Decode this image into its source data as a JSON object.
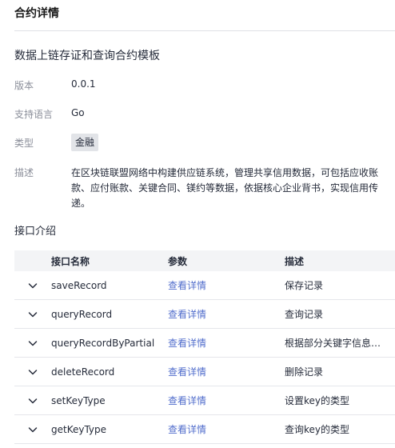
{
  "header": {
    "title": "合约详情"
  },
  "template": {
    "name": "数据上链存证和查询合约模板",
    "fields": {
      "version_label": "版本",
      "version_value": "0.0.1",
      "lang_label": "支持语言",
      "lang_value": "Go",
      "type_label": "类型",
      "type_value": "金融",
      "desc_label": "描述",
      "desc_value": "在区块链联盟网络中构建供应链系统，管理共享信用数据，可包括应收账款、应付账款、关键合同、镁约等数据，依据核心企业背书，实现信用传递。"
    }
  },
  "interfaces": {
    "title": "接口介绍",
    "columns": [
      "接口名称",
      "参数",
      "描述"
    ],
    "rows": [
      {
        "name": "saveRecord",
        "param": "查看详情",
        "desc": "保存记录"
      },
      {
        "name": "queryRecord",
        "param": "查看详情",
        "desc": "查询记录"
      },
      {
        "name": "queryRecordByPartial",
        "param": "查看详情",
        "desc": "根据部分关键字信息…"
      },
      {
        "name": "deleteRecord",
        "param": "查看详情",
        "desc": "删除记录"
      },
      {
        "name": "setKeyType",
        "param": "查看详情",
        "desc": "设置key的类型"
      },
      {
        "name": "getKeyType",
        "param": "查看详情",
        "desc": "查询key的类型"
      }
    ]
  },
  "icons": {
    "row_expand": "chevron-down-icon"
  },
  "colors": {
    "link": "#526ecc",
    "tag_bg": "#e2e4e8",
    "header_bg": "#f3f4f6"
  }
}
